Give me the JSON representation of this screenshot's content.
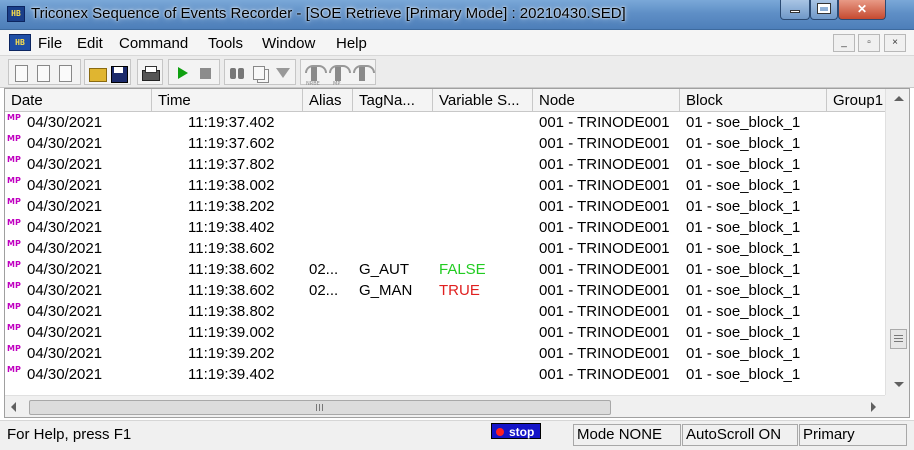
{
  "window": {
    "title": "Triconex Sequence of Events Recorder - [SOE Retrieve [Primary Mode] : 20210430.SED]",
    "icon_text": "HB",
    "buttons": [
      "minimize",
      "maximize",
      "close"
    ]
  },
  "menubar": {
    "items": [
      "File",
      "Edit",
      "Command",
      "Tools",
      "Window",
      "Help"
    ]
  },
  "toolbar": {
    "mini_labels": [
      "NRBE",
      "MP",
      ""
    ]
  },
  "table": {
    "columns": [
      "Date",
      "Time",
      "Alias",
      "TagNa...",
      "Variable S...",
      "Node",
      "Block",
      "Group1"
    ],
    "row_marker": "MP",
    "rows": [
      {
        "date": "04/30/2021",
        "time": "11:19:37.402",
        "alias": "",
        "tag": "",
        "state": "",
        "node": "001 - TRINODE001",
        "block": "01 - soe_block_1"
      },
      {
        "date": "04/30/2021",
        "time": "11:19:37.602",
        "alias": "",
        "tag": "",
        "state": "",
        "node": "001 - TRINODE001",
        "block": "01 - soe_block_1"
      },
      {
        "date": "04/30/2021",
        "time": "11:19:37.802",
        "alias": "",
        "tag": "",
        "state": "",
        "node": "001 - TRINODE001",
        "block": "01 - soe_block_1"
      },
      {
        "date": "04/30/2021",
        "time": "11:19:38.002",
        "alias": "",
        "tag": "",
        "state": "",
        "node": "001 - TRINODE001",
        "block": "01 - soe_block_1"
      },
      {
        "date": "04/30/2021",
        "time": "11:19:38.202",
        "alias": "",
        "tag": "",
        "state": "",
        "node": "001 - TRINODE001",
        "block": "01 - soe_block_1"
      },
      {
        "date": "04/30/2021",
        "time": "11:19:38.402",
        "alias": "",
        "tag": "",
        "state": "",
        "node": "001 - TRINODE001",
        "block": "01 - soe_block_1"
      },
      {
        "date": "04/30/2021",
        "time": "11:19:38.602",
        "alias": "",
        "tag": "",
        "state": "",
        "node": "001 - TRINODE001",
        "block": "01 - soe_block_1"
      },
      {
        "date": "04/30/2021",
        "time": "11:19:38.602",
        "alias": "02...",
        "tag": "G_AUT",
        "state": "FALSE",
        "node": "001 - TRINODE001",
        "block": "01 - soe_block_1"
      },
      {
        "date": "04/30/2021",
        "time": "11:19:38.602",
        "alias": "02...",
        "tag": "G_MAN",
        "state": "TRUE",
        "node": "001 - TRINODE001",
        "block": "01 - soe_block_1"
      },
      {
        "date": "04/30/2021",
        "time": "11:19:38.802",
        "alias": "",
        "tag": "",
        "state": "",
        "node": "001 - TRINODE001",
        "block": "01 - soe_block_1"
      },
      {
        "date": "04/30/2021",
        "time": "11:19:39.002",
        "alias": "",
        "tag": "",
        "state": "",
        "node": "001 - TRINODE001",
        "block": "01 - soe_block_1"
      },
      {
        "date": "04/30/2021",
        "time": "11:19:39.202",
        "alias": "",
        "tag": "",
        "state": "",
        "node": "001 - TRINODE001",
        "block": "01 - soe_block_1"
      },
      {
        "date": "04/30/2021",
        "time": "11:19:39.402",
        "alias": "",
        "tag": "",
        "state": "",
        "node": "001 - TRINODE001",
        "block": "01 - soe_block_1"
      }
    ]
  },
  "statusbar": {
    "help": "For Help, press F1",
    "stop_label": "stop",
    "mode": "Mode NONE",
    "autoscroll": "AutoScroll ON",
    "primary": "Primary"
  },
  "colors": {
    "false_state": "#22cc22",
    "true_state": "#e02020",
    "mp_marker": "#c000c0",
    "stop_badge": "#1414c8"
  }
}
